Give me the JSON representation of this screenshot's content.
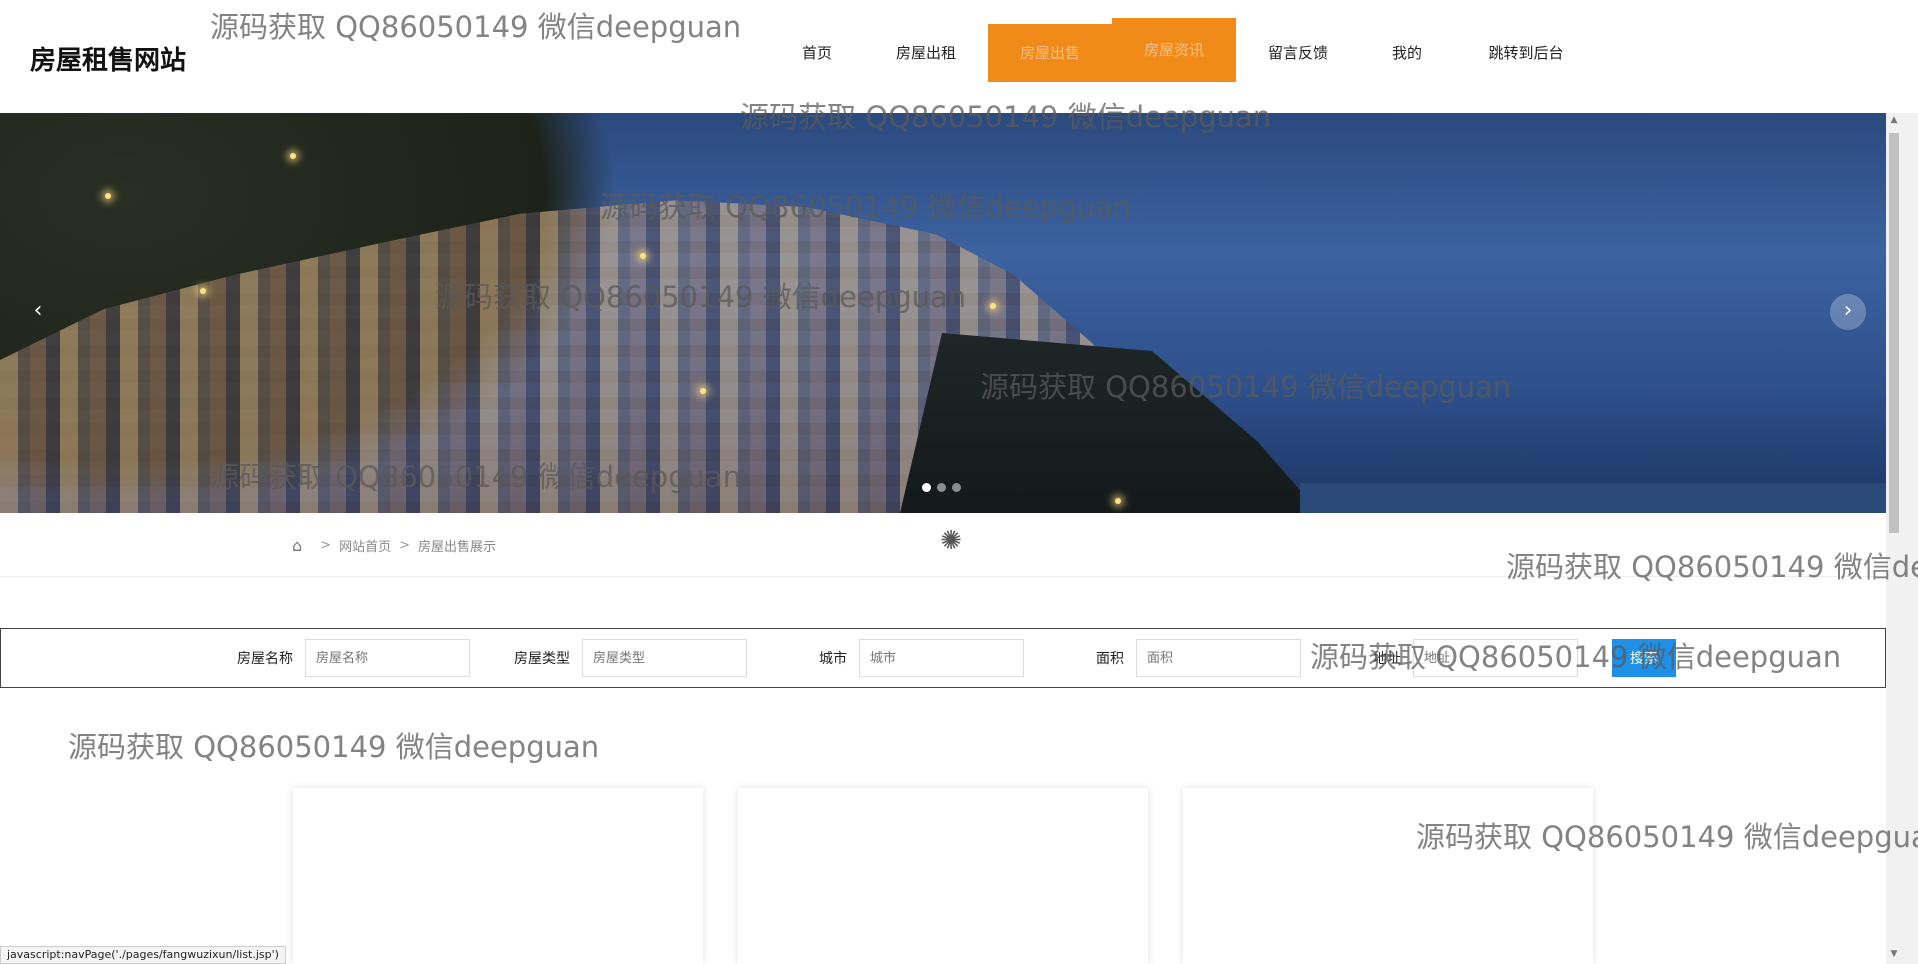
{
  "site": {
    "title": "房屋租售网站"
  },
  "nav": {
    "items": [
      {
        "label": "首页"
      },
      {
        "label": "房屋出租"
      },
      {
        "label": "房屋出售"
      },
      {
        "label": "房屋资讯"
      },
      {
        "label": "留言反馈"
      },
      {
        "label": "我的"
      },
      {
        "label": "跳转到后台"
      }
    ],
    "active_index": 2,
    "hover_index": 3
  },
  "banner": {
    "prev_icon": "chevron-left-icon",
    "next_icon": "chevron-right-icon",
    "slide_count": 3,
    "active_slide": 1
  },
  "breadcrumb": {
    "home_icon": "home-icon",
    "items": [
      "网站首页",
      "房屋出售展示"
    ]
  },
  "search": {
    "fields": [
      {
        "label": "房屋名称",
        "placeholder": "房屋名称"
      },
      {
        "label": "房屋类型",
        "placeholder": "房屋类型"
      },
      {
        "label": "城市",
        "placeholder": "城市"
      },
      {
        "label": "面积",
        "placeholder": "面积"
      },
      {
        "label": "地址",
        "placeholder": "地址"
      }
    ],
    "button_label": "搜索"
  },
  "status_bar": {
    "text": "javascript:navPage('./pages/fangwuzixun/list.jsp')"
  },
  "watermark": {
    "text": "源码获取 QQ86050149 微信deepguan"
  },
  "colors": {
    "accent": "#f08a19",
    "button": "#1e90e8"
  }
}
